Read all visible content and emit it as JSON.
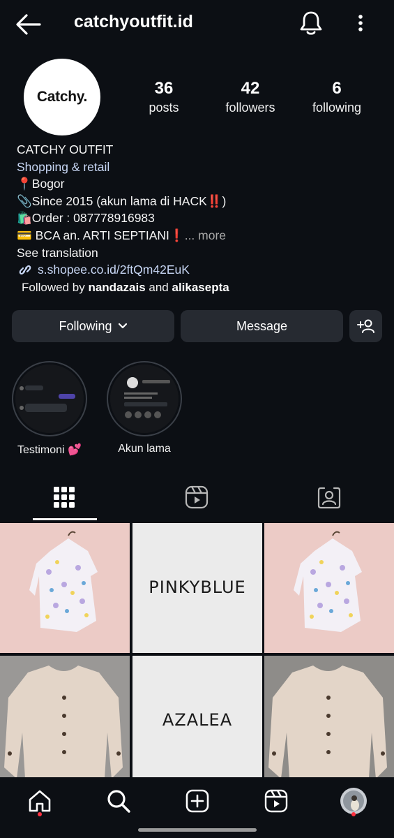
{
  "header": {
    "username": "catchyoutfit.id",
    "back_icon": "arrow-left-icon",
    "notification_icon": "bell-icon",
    "menu_icon": "more-vertical-icon"
  },
  "profile": {
    "avatar_text": "Catchy.",
    "stats": [
      {
        "count": "36",
        "label": "posts"
      },
      {
        "count": "42",
        "label": "followers"
      },
      {
        "count": "6",
        "label": "following"
      }
    ],
    "name": "CATCHY OUTFIT",
    "category": "Shopping & retail",
    "bio_lines": [
      "📍Bogor",
      "📎Since 2015 (akun lama di HACK‼️)",
      "🛍️Order : 087778916983"
    ],
    "bio_last_line": "💳 BCA an. ARTI SEPTIANI❗",
    "more_label": "... more",
    "see_translation": "See translation",
    "link": "s.shopee.co.id/2ftQm42EuK",
    "followed_by_prefix": "Followed by",
    "followed_by_user1": "nandazais",
    "followed_by_and": "and",
    "followed_by_user2": "alikasepta"
  },
  "actions": {
    "following_label": "Following",
    "message_label": "Message"
  },
  "highlights": [
    {
      "label": "Testimoni 💕"
    },
    {
      "label": "Akun lama"
    }
  ],
  "tabs": [
    "grid-icon",
    "reels-icon",
    "tagged-icon"
  ],
  "posts": [
    {
      "type": "image",
      "desc": "floral blouse on pink"
    },
    {
      "type": "text",
      "text": "PINKYBLUE"
    },
    {
      "type": "image",
      "desc": "floral blouse on pink"
    },
    {
      "type": "image",
      "desc": "beige ribbed cardigan"
    },
    {
      "type": "text",
      "text": "AZALEA"
    },
    {
      "type": "image",
      "desc": "beige ribbed cardigan"
    }
  ],
  "bottom_nav": [
    "home-icon",
    "search-icon",
    "create-icon",
    "reels-icon",
    "profile-avatar"
  ],
  "colors": {
    "background": "#0c0f14",
    "button": "#262a31",
    "link": "#c8d7f5",
    "notification_dot": "#ff3040"
  }
}
